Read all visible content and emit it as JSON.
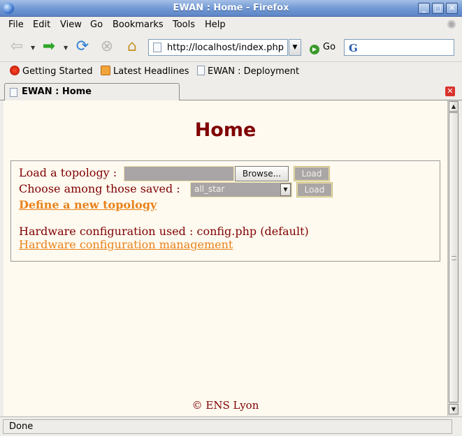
{
  "window": {
    "title": "EWAN : Home - Firefox"
  },
  "menubar": {
    "items": [
      "File",
      "Edit",
      "View",
      "Go",
      "Bookmarks",
      "Tools",
      "Help"
    ]
  },
  "navbar": {
    "url": "http://localhost/index.php",
    "go_label": "Go",
    "search_value": ""
  },
  "bookmarks": {
    "items": [
      "Getting Started",
      "Latest Headlines",
      "EWAN : Deployment"
    ]
  },
  "tabs": [
    {
      "label": "EWAN : Home"
    }
  ],
  "page": {
    "title": "Home",
    "load_topology_label": "Load a topology :",
    "browse_label": "Browse...",
    "load_label": "Load",
    "choose_saved_label": "Choose among those saved :",
    "saved_selected": "all_star",
    "load_saved_label": "Load",
    "define_new_link": "Define a new topology",
    "hardware_text": "Hardware configuration used : config.php (default)",
    "hardware_link": "Hardware configuration management",
    "footer": "© ENS Lyon"
  },
  "status": {
    "text": "Done"
  },
  "colors": {
    "page_background": "#fffaf0",
    "heading": "#7f0000",
    "link": "#e8821a",
    "titlebar": "#6f97d3"
  }
}
